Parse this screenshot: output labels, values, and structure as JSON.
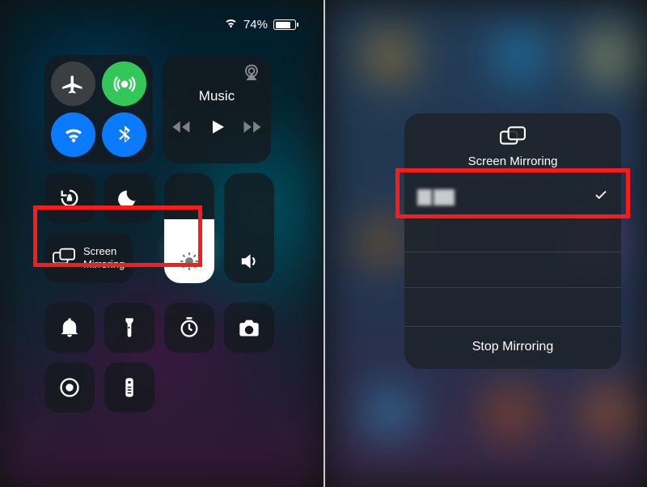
{
  "status": {
    "battery_pct": "74%"
  },
  "cc": {
    "music": {
      "title": "Music"
    },
    "screen_mirroring": {
      "label_line1": "Screen",
      "label_line2": "Mirroring"
    }
  },
  "sheet": {
    "title": "Screen Mirroring",
    "device_name": "(redacted)",
    "stop_label": "Stop Mirroring"
  },
  "icons": {
    "wifi": "wifi-icon",
    "airplane": "airplane-icon",
    "cellular": "cellular-icon",
    "bluetooth": "bluetooth-icon",
    "airplay": "airplay-icon",
    "lock_rotation": "rotation-lock-icon",
    "moon": "do-not-disturb-icon",
    "brightness": "brightness-icon",
    "volume": "volume-icon",
    "bell": "bell-icon",
    "flashlight": "flashlight-icon",
    "timer": "timer-icon",
    "camera": "camera-icon",
    "record": "screen-record-icon",
    "remote": "apple-tv-remote-icon",
    "check": "checkmark-icon",
    "mirror": "screen-mirroring-icon"
  },
  "colors": {
    "highlight": "#ff1a1a",
    "accent": "#0a7aff",
    "green": "#33c759"
  }
}
